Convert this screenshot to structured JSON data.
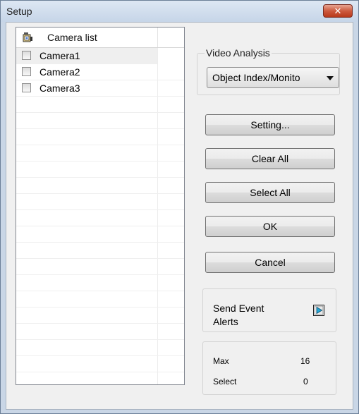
{
  "window": {
    "title": "Setup",
    "close_icon": "close-icon"
  },
  "camera_list": {
    "header": "Camera list",
    "header_icon": "camera-list-icon",
    "items": [
      {
        "label": "Camera1",
        "checked": false,
        "selected": true
      },
      {
        "label": "Camera2",
        "checked": false,
        "selected": false
      },
      {
        "label": "Camera3",
        "checked": false,
        "selected": false
      }
    ]
  },
  "video_analysis": {
    "label": "Video Analysis",
    "selected": "Object Index/Monito"
  },
  "buttons": {
    "setting": "Setting...",
    "clear_all": "Clear All",
    "select_all": "Select All",
    "ok": "OK",
    "cancel": "Cancel"
  },
  "alerts": {
    "label": "Send Event Alerts",
    "icon": "play-icon"
  },
  "stats": {
    "max_label": "Max",
    "max_value": "16",
    "select_label": "Select",
    "select_value": "0"
  },
  "colors": {
    "close_button": "#c9462a",
    "title_bar": "#c6d5e8"
  }
}
